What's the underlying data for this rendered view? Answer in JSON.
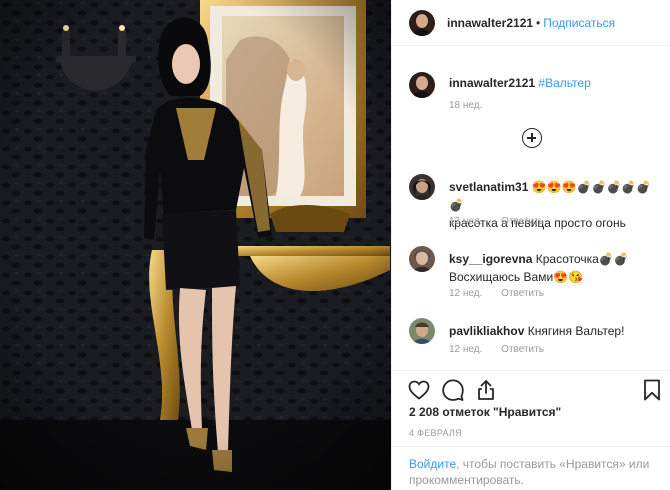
{
  "header": {
    "username": "innawalter2121",
    "separator": "•",
    "follow_label": "Подписаться"
  },
  "caption": {
    "username": "innawalter2121",
    "hashtag": "#Вальтер",
    "time": "18 нед."
  },
  "load_more_icon": "plus-circle-icon",
  "comments": [
    {
      "username": "svetlanatim31",
      "text": "😍😍😍💣💣💣💣💣💣",
      "text2": "красотка а певица просто огонь",
      "time": "13 нед.",
      "reply_label": "Ответить"
    },
    {
      "username": "ksy__igorevna",
      "text": "Красоточка💣💣",
      "text2": "Восхищаюсь Вами😍😘",
      "time": "12 нед.",
      "reply_label": "Ответить"
    },
    {
      "username": "pavlikliakhov",
      "text": "Княгиня Вальтер!",
      "time": "12 нед.",
      "reply_label": "Ответить"
    }
  ],
  "actions": {
    "like_icon": "heart-icon",
    "comment_icon": "comment-bubble-icon",
    "share_icon": "share-icon",
    "save_icon": "bookmark-icon"
  },
  "likes_text": "2 208 отметок \"Нравится\"",
  "date": "4 ФЕВРАЛЯ",
  "login_prompt": {
    "link": "Войдите",
    "text": ", чтобы поставить «Нравится» или прокомментировать."
  },
  "colors": {
    "link": "#3897f0",
    "muted": "#999999",
    "text": "#262626",
    "border": "#efefef"
  }
}
